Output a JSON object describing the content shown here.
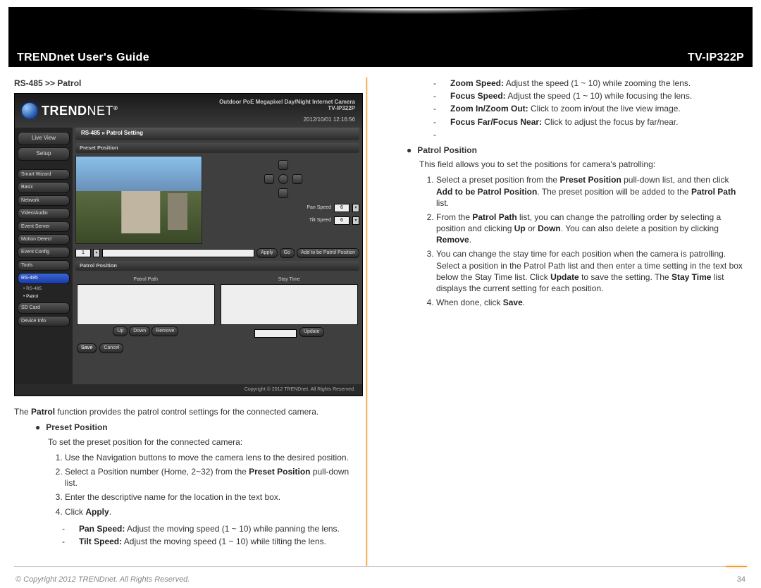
{
  "header": {
    "title_left": "TRENDnet User's Guide",
    "title_right": "TV-IP322P"
  },
  "left": {
    "section_heading": "RS-485 >> Patrol",
    "shot": {
      "brand_prefix": "TREND",
      "brand_suffix": "NET",
      "subtitle_line1": "Outdoor PoE Megapixel Day/Night Internet Camera",
      "subtitle_line2": "TV-IP322P",
      "timestamp": "2012/10/01 12:16:56",
      "btn_liveview": "Live View",
      "btn_setup": "Setup",
      "nav_items": [
        "Smart Wizard",
        "Basic",
        "Network",
        "Video/Audio",
        "Event Server",
        "Motion Detect",
        "Event Config",
        "Tools",
        "RS-485",
        "SD Card",
        "Device Info"
      ],
      "sub_items": [
        "RS-485",
        "Patrol"
      ],
      "crumb": "RS-485 » Patrol Setting",
      "panel_preset": "Preset Position",
      "panel_patrol": "Patrol Position",
      "pan_speed_label": "Pan Speed",
      "tilt_speed_label": "Tilt Speed",
      "pan_speed": "6",
      "tilt_speed": "6",
      "preset_select": "1",
      "btn_apply": "Apply",
      "btn_go": "Go",
      "btn_add": "Add to be Patrol Position",
      "list_patrol_label": "Patrol Path",
      "list_stay_label": "Stay Time",
      "btn_up": "Up",
      "btn_down": "Down",
      "btn_remove": "Remove",
      "btn_update": "Update",
      "btn_save": "Save",
      "btn_cancel": "Cancel",
      "footer": "Copyright © 2012 TRENDnet. All Rights Reserved."
    },
    "intro_before": "The ",
    "intro_bold": "Patrol",
    "intro_after": " function provides the patrol control settings for the connected camera.",
    "preset_heading": "Preset Position",
    "preset_intro": "To set the preset position for the connected camera:",
    "preset_steps": [
      "Use the Navigation buttons to move the camera lens to the desired position.",
      "Select a Position number (Home, 2~32) from the Preset Position pull-down list.",
      "Enter the descriptive name for the location in the text box.",
      "Click Apply."
    ],
    "dash_items": [
      {
        "b": "Pan Speed:",
        "t": " Adjust the moving speed (1 ~ 10) while panning the lens."
      },
      {
        "b": "Tilt Speed:",
        "t": " Adjust the moving speed (1 ~ 10) while tilting the lens."
      }
    ]
  },
  "right": {
    "dash_items": [
      {
        "b": "Zoom Speed:",
        "t": " Adjust the speed (1 ~ 10) while zooming the lens."
      },
      {
        "b": "Focus Speed:",
        "t": " Adjust the speed (1 ~ 10) while focusing the lens."
      },
      {
        "b": "Zoom In/Zoom Out:",
        "t": " Click to zoom in/out the live view image."
      },
      {
        "b": "Focus Far/Focus Near:",
        "t": " Click to adjust the focus by far/near."
      },
      {
        "b": "",
        "t": ""
      }
    ],
    "patrol_heading": "Patrol Position",
    "patrol_intro": "This field allows you to set the positions for camera's patrolling:",
    "patrol_steps": [
      "Select a preset position from the Preset Position pull-down list, and then click Add to be Patrol Position. The preset position will be added to the Patrol Path list.",
      "From the Patrol Path list, you can change the patrolling order by selecting a position and clicking Up or Down. You can also delete a position by clicking Remove.",
      "You can change the stay time for each position when the camera is patrolling. Select a position in the Patrol Path list and then enter a time setting in the text box below the Stay Time list. Click Update to save the setting. The Stay Time list displays the current setting for each position.",
      "When done, click Save."
    ]
  },
  "footer": {
    "copyright": "© Copyright 2012 TRENDnet. All Rights Reserved.",
    "pageno": "34"
  }
}
